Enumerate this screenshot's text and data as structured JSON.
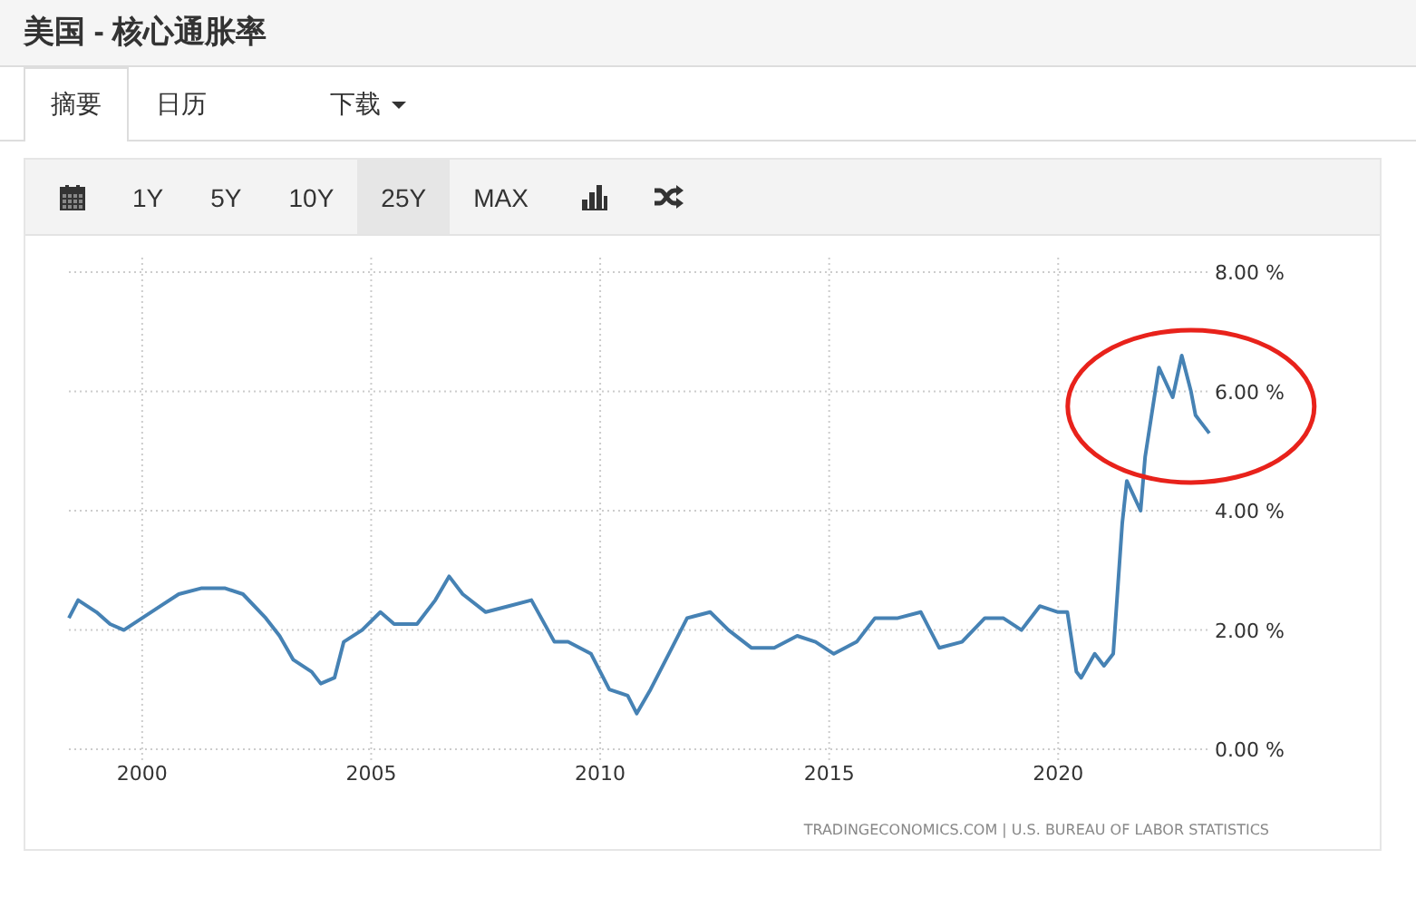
{
  "title": "美国 - 核心通胀率",
  "tabs": [
    {
      "label": "摘要",
      "selected": true,
      "dropdown": false
    },
    {
      "label": "日历",
      "selected": false,
      "dropdown": false
    },
    {
      "label": "下载",
      "selected": false,
      "dropdown": true
    }
  ],
  "toolbar": [
    {
      "kind": "calendar"
    },
    {
      "kind": "range",
      "label": "1Y",
      "selected": false
    },
    {
      "kind": "range",
      "label": "5Y",
      "selected": false
    },
    {
      "kind": "range",
      "label": "10Y",
      "selected": false
    },
    {
      "kind": "range",
      "label": "25Y",
      "selected": true
    },
    {
      "kind": "range",
      "label": "MAX",
      "selected": false
    },
    {
      "kind": "bars"
    },
    {
      "kind": "shuffle"
    }
  ],
  "chart": {
    "chart_data": {
      "type": "line",
      "x": [
        1998.4,
        1998.6,
        1999,
        1999.3,
        1999.6,
        2000,
        2000.4,
        2000.8,
        2001.3,
        2001.8,
        2002.2,
        2002.7,
        2003,
        2003.3,
        2003.7,
        2003.9,
        2004.2,
        2004.4,
        2004.8,
        2005.2,
        2005.5,
        2006,
        2006.4,
        2006.7,
        2007,
        2007.5,
        2008,
        2008.5,
        2009,
        2009.3,
        2009.8,
        2010.2,
        2010.6,
        2010.8,
        2011.1,
        2011.5,
        2011.9,
        2012.4,
        2012.8,
        2013.3,
        2013.8,
        2014.3,
        2014.7,
        2015.1,
        2015.6,
        2016,
        2016.5,
        2017,
        2017.4,
        2017.9,
        2018.4,
        2018.8,
        2019.2,
        2019.6,
        2020,
        2020.2,
        2020.4,
        2020.5,
        2020.8,
        2021,
        2021.2,
        2021.4,
        2021.5,
        2021.8,
        2021.9,
        2022.2,
        2022.5,
        2022.7,
        2022.9,
        2023,
        2023.1,
        2023.3
      ],
      "series": [
        {
          "color": "#4682b4",
          "values": [
            2.2,
            2.5,
            2.3,
            2.1,
            2.0,
            2.2,
            2.4,
            2.6,
            2.7,
            2.7,
            2.6,
            2.2,
            1.9,
            1.5,
            1.3,
            1.1,
            1.2,
            1.8,
            2.0,
            2.3,
            2.1,
            2.1,
            2.5,
            2.9,
            2.6,
            2.3,
            2.4,
            2.5,
            1.8,
            1.8,
            1.6,
            1.0,
            0.9,
            0.6,
            1.0,
            1.6,
            2.2,
            2.3,
            2.0,
            1.7,
            1.7,
            1.9,
            1.8,
            1.6,
            1.8,
            2.2,
            2.2,
            2.3,
            1.7,
            1.8,
            2.2,
            2.2,
            2.0,
            2.4,
            2.3,
            2.3,
            1.3,
            1.2,
            1.6,
            1.4,
            1.6,
            3.8,
            4.5,
            4.0,
            4.9,
            6.4,
            5.9,
            6.6,
            6.0,
            5.6,
            5.5,
            5.3
          ]
        }
      ],
      "xlim": [
        1998.4,
        2023.3
      ],
      "ylim": [
        0,
        8
      ],
      "xticks": [
        2000,
        2005,
        2010,
        2015,
        2020
      ],
      "yticks": [
        {
          "value": 0,
          "label": "0.00 %"
        },
        {
          "value": 2,
          "label": "2.00 %"
        },
        {
          "value": 4,
          "label": "4.00 %"
        },
        {
          "value": 6,
          "label": "6.00 %"
        },
        {
          "value": 8,
          "label": "8.00 %"
        }
      ],
      "grid": true
    },
    "highlight": true,
    "source": "TRADINGECONOMICS.COM | U.S. BUREAU OF LABOR STATISTICS"
  }
}
